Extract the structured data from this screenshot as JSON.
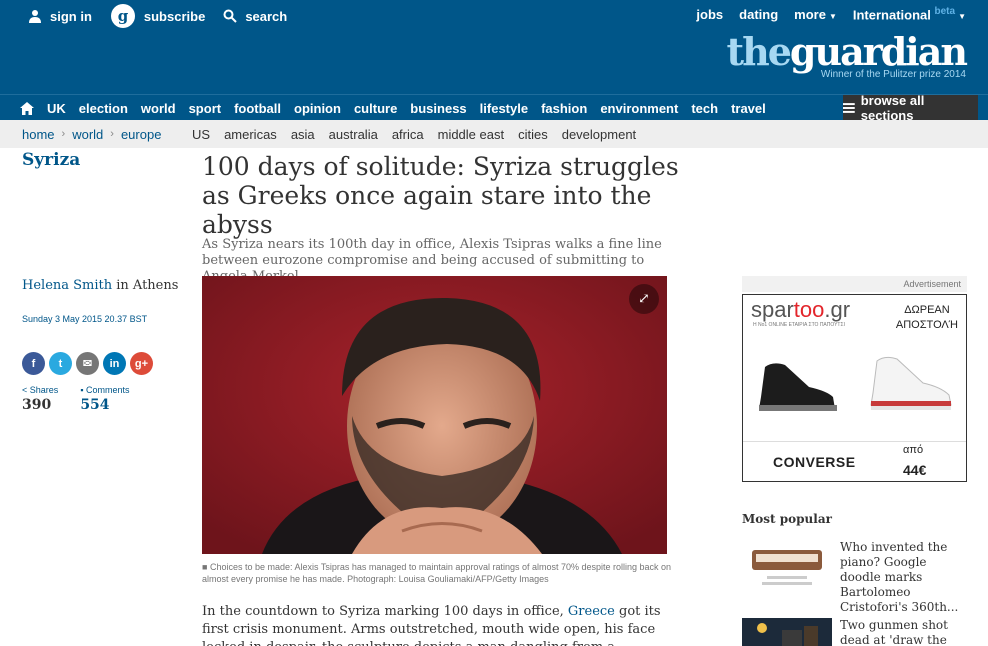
{
  "header": {
    "sign_in": "sign in",
    "subscribe": "subscribe",
    "search": "search",
    "jobs": "jobs",
    "dating": "dating",
    "more": "more",
    "international": "International",
    "beta": "beta",
    "logo_the": "the",
    "logo_guardian": "guardian",
    "logo_tagline": "Winner of the Pulitzer prize 2014"
  },
  "nav": {
    "items": [
      "UK",
      "election",
      "world",
      "sport",
      "football",
      "opinion",
      "culture",
      "business",
      "lifestyle",
      "fashion",
      "environment",
      "tech",
      "travel"
    ],
    "browse": "browse all sections"
  },
  "subnav": {
    "crumbs": [
      "home",
      "world",
      "europe"
    ],
    "regions": [
      "US",
      "americas",
      "asia",
      "australia",
      "africa",
      "middle east",
      "cities",
      "development"
    ]
  },
  "article": {
    "kicker": "Syriza",
    "headline": "100 days of solitude: Syriza struggles as Greeks once again stare into the abyss",
    "standfirst": "As Syriza nears its 100th day in office, Alexis Tsipras walks a fine line between eurozone compromise and being accused of submitting to Angela Merkel",
    "author": "Helena Smith",
    "location": " in Athens",
    "date": "Sunday 3 May 2015 20.37 BST",
    "shares_label": "Shares",
    "shares_count": "390",
    "comments_label": "Comments",
    "comments_count": "554",
    "caption": "Choices to be made: Alexis Tsipras has managed to maintain approval ratings of almost 70% despite rolling back on almost every promise he has made. Photograph: Louisa Gouliamaki/AFP/Getty Images",
    "body_pre": "In the countdown to Syriza marking 100 days in office, ",
    "body_link": "Greece",
    "body_post": " got its first crisis monument. Arms outstretched, mouth wide open, his face locked in despair, the sculpture depicts a man dangling from a financial index in free fall. Below, his"
  },
  "share_buttons": [
    {
      "name": "facebook",
      "glyph": "f",
      "color": "#3b5998"
    },
    {
      "name": "twitter",
      "glyph": "t",
      "color": "#2aa9e0"
    },
    {
      "name": "email",
      "glyph": "✉",
      "color": "#767676"
    },
    {
      "name": "linkedin",
      "glyph": "in",
      "color": "#0077b5"
    },
    {
      "name": "googleplus",
      "glyph": "g+",
      "color": "#dd4b39"
    }
  ],
  "ad": {
    "label": "Advertisement",
    "brand_a": "spar",
    "brand_b": "too",
    "brand_c": ".gr",
    "tagline": "Η Νο1 ONLINE ΕΤΑΙΡΙΑ ΣΤΟ ΠΑΠΟΥΤΣΙ",
    "offer_line1": "ΔΩΡΕΑΝ",
    "offer_line2": "ΑΠΟΣΤΟΛΉ",
    "product_brand": "CONVERSE",
    "from": "από",
    "price": "44€"
  },
  "most_popular": {
    "title": "Most popular",
    "items": [
      {
        "text": "Who invented the piano? Google doodle marks Bartolomeo Cristofori's 360th..."
      },
      {
        "text": "Two gunmen shot dead at 'draw the prophet"
      }
    ]
  }
}
